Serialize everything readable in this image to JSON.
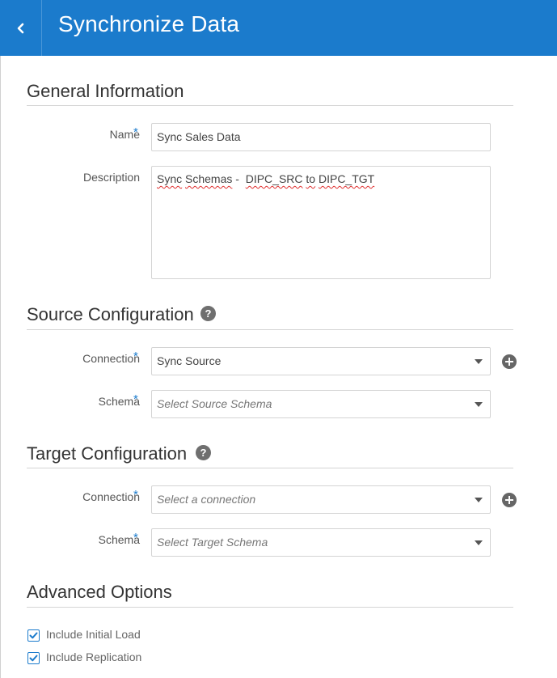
{
  "header": {
    "title": "Synchronize Data",
    "back_icon": "chevron-left-icon",
    "color": "#1b7bcc"
  },
  "general": {
    "title": "General Information",
    "name_label": "Name",
    "name_value": "Sync Sales Data",
    "description_label": "Description",
    "description_value": [
      "Sync",
      " ",
      "Schemas",
      " -  ",
      "DIPC_SRC",
      " ",
      "to",
      " ",
      "DIPC_TGT"
    ]
  },
  "source": {
    "title": "Source Configuration",
    "help_icon": "?",
    "connection_label": "Connection",
    "connection_value": "Sync Source",
    "schema_label": "Schema",
    "schema_placeholder": "Select Source Schema"
  },
  "target": {
    "title": "Target Configuration",
    "help_icon": "?",
    "connection_label": "Connection",
    "connection_placeholder": "Select a connection",
    "schema_label": "Schema",
    "schema_placeholder": "Select Target Schema"
  },
  "advanced": {
    "title": "Advanced Options",
    "options": [
      {
        "label": "Include Initial Load",
        "checked": true
      },
      {
        "label": "Include Replication",
        "checked": true
      }
    ]
  },
  "required_mark": "*"
}
